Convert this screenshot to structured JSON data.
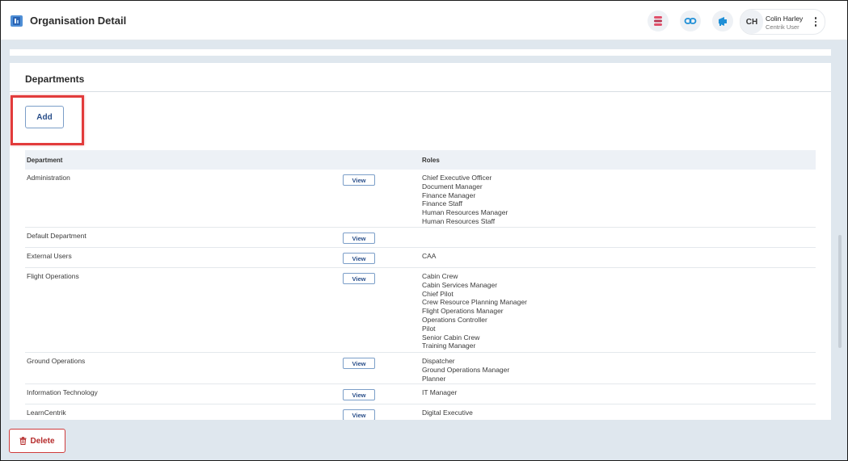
{
  "header": {
    "title": "Organisation Detail",
    "icons": [
      "stack-icon",
      "link-icon",
      "megaphone-icon"
    ],
    "user": {
      "initials": "CH",
      "name": "Colin Harley",
      "role": "Centrik User"
    }
  },
  "departments": {
    "title": "Departments",
    "add_label": "Add",
    "columns": {
      "department": "Department",
      "roles": "Roles"
    },
    "view_label": "View",
    "rows": [
      {
        "name": "Administration",
        "roles": [
          "Chief Executive Officer",
          "Document Manager",
          "Finance Manager",
          "Finance Staff",
          "Human Resources Manager",
          "Human Resources Staff"
        ]
      },
      {
        "name": "Default Department",
        "roles": []
      },
      {
        "name": "External Users",
        "roles": [
          "CAA"
        ]
      },
      {
        "name": "Flight Operations",
        "roles": [
          "Cabin Crew",
          "Cabin Services Manager",
          "Chief Pilot",
          "Crew Resource Planning Manager",
          "Flight Operations Manager",
          "Operations Controller",
          "Pilot",
          "Senior Cabin Crew",
          "Training Manager"
        ]
      },
      {
        "name": "Ground Operations",
        "roles": [
          "Dispatcher",
          "Ground Operations Manager",
          "Planner"
        ]
      },
      {
        "name": "Information Technology",
        "roles": [
          "IT Manager"
        ]
      },
      {
        "name": "LearnCentrik",
        "roles": [
          "Digital Executive"
        ]
      }
    ]
  },
  "footer": {
    "delete_label": "Delete"
  },
  "colors": {
    "accent": "#2a4f8a",
    "danger": "#cf3b3b",
    "highlight": "#e23b3b"
  }
}
